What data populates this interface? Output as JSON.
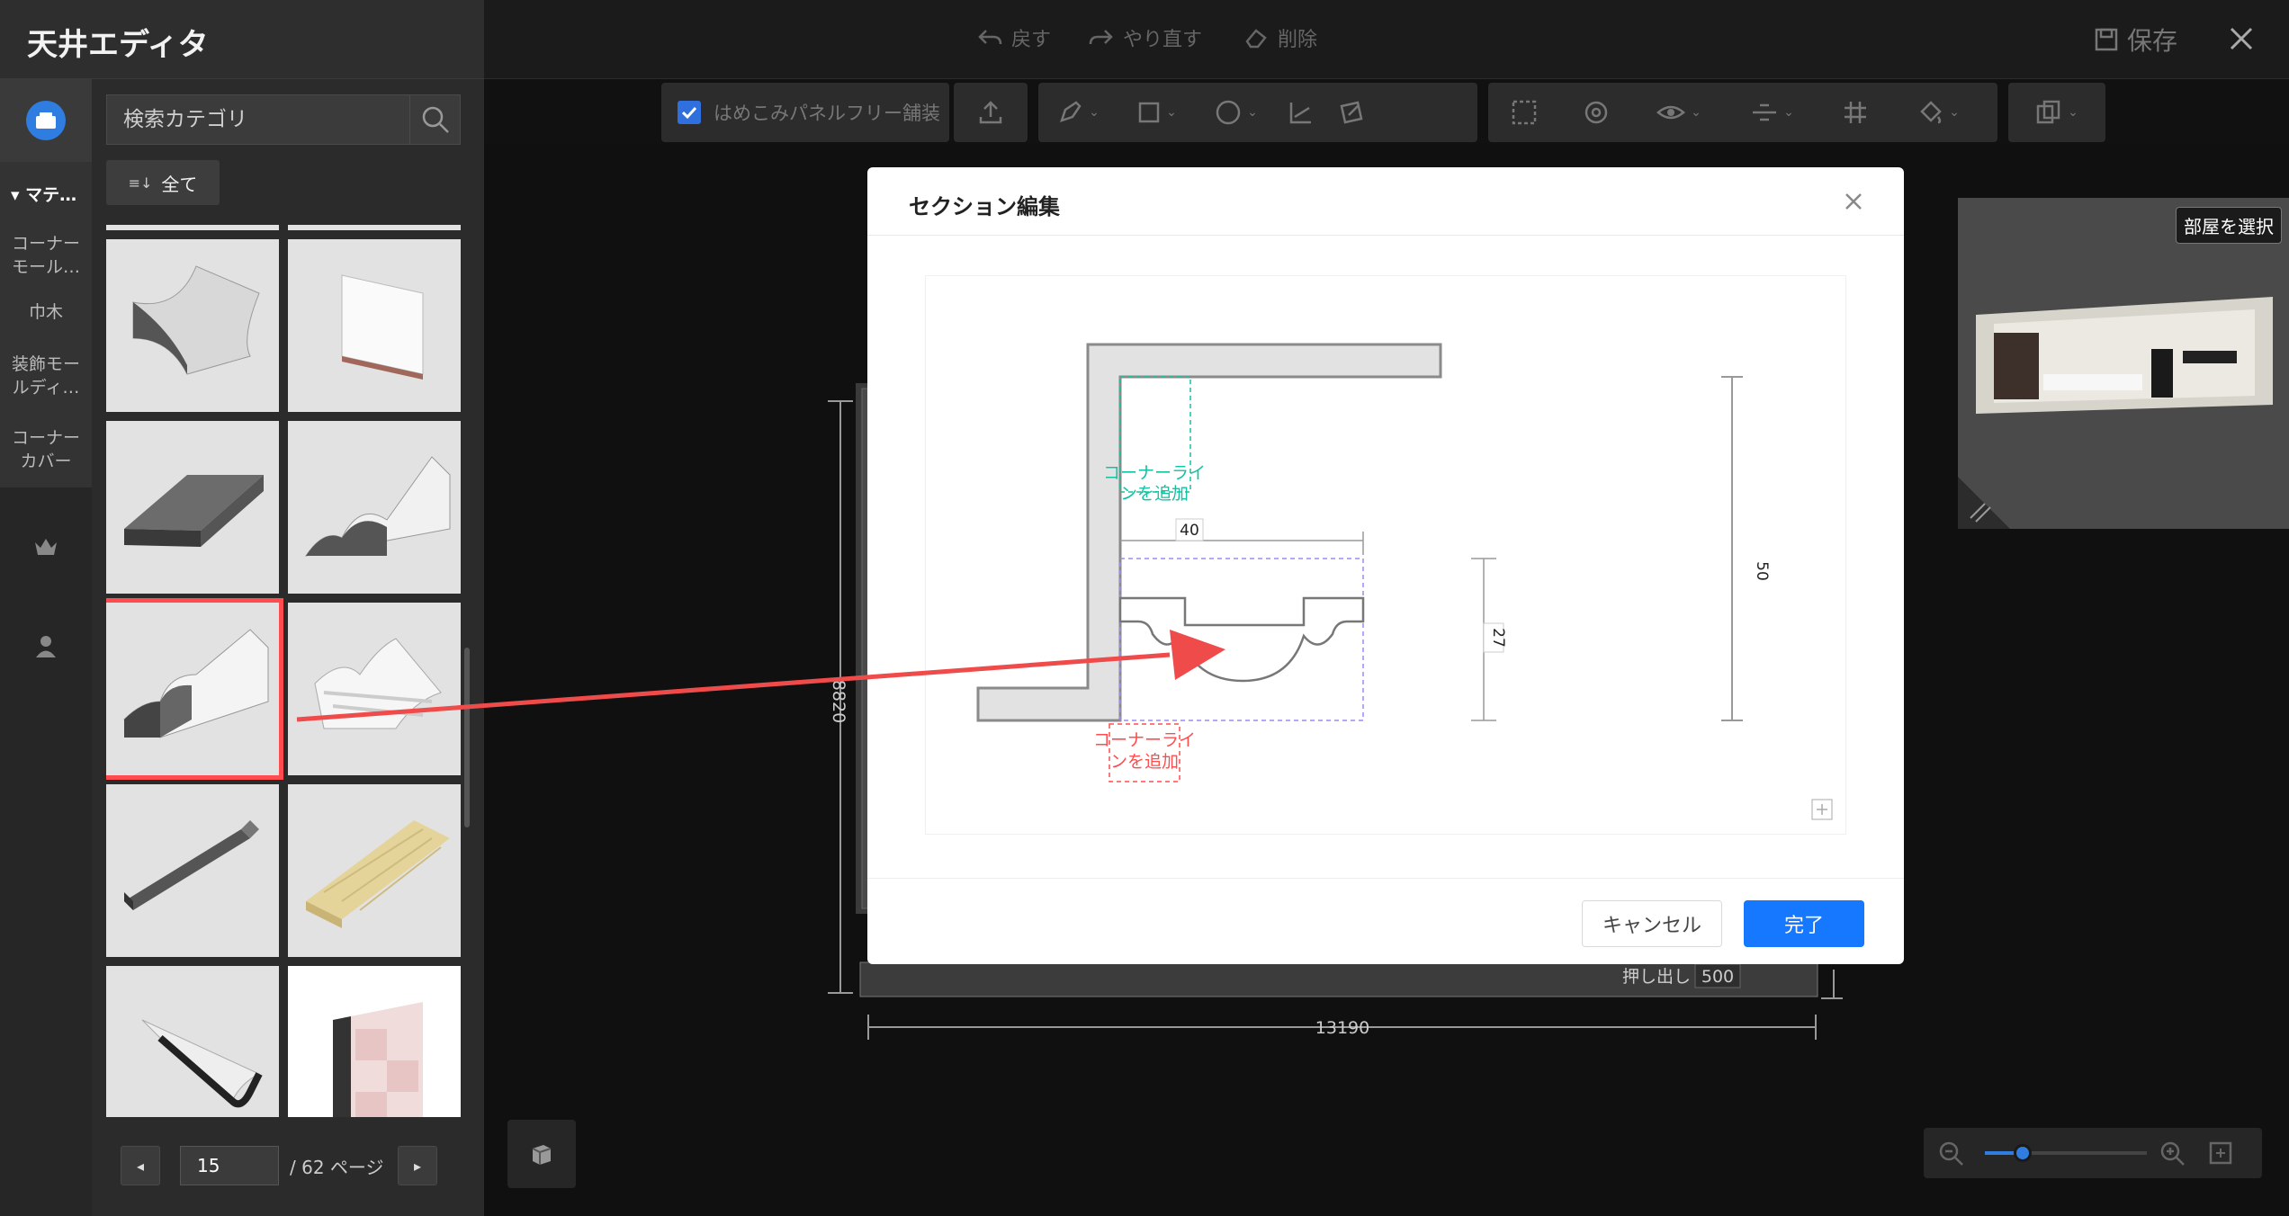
{
  "app": {
    "title": "天井エディタ"
  },
  "search": {
    "placeholder": "検索カテゴリ"
  },
  "filter": {
    "all_label": "全て"
  },
  "categories": {
    "heading": "マテ…",
    "items": [
      {
        "label": "コーナーモール…"
      },
      {
        "label": "巾木"
      },
      {
        "label": "装飾モールディ…"
      },
      {
        "label": "コーナーカバー"
      }
    ]
  },
  "rail_icons": [
    "material-icon",
    "crown-icon",
    "user-icon"
  ],
  "pager": {
    "current": "15",
    "total_label": "/ 62 ページ"
  },
  "topbar": {
    "undo": "戻す",
    "redo": "やり直す",
    "delete": "削除",
    "save": "保存"
  },
  "toolbar": {
    "fill_checkbox_label": "はめこみパネルフリー舗装"
  },
  "canvas": {
    "dim_width": "13190",
    "dim_height": "8820",
    "extrude_label": "押し出し",
    "extrude_value": "500"
  },
  "preview": {
    "select_room": "部屋を選択"
  },
  "modal": {
    "title": "セクション編集",
    "cancel": "キャンセル",
    "done": "完了",
    "add_corner_line_top": [
      "コーナーライ",
      "ンを追加"
    ],
    "add_corner_line_bottom": [
      "コーナーライ",
      "ンを追加"
    ],
    "dim_40": "40",
    "dim_27": "27",
    "dim_50": "50"
  },
  "colors": {
    "accent": "#1677ff",
    "highlight": "#ff4d4f",
    "corner_line_teal": "#13c2a2",
    "corner_line_red": "#ff4d4f",
    "profile_box": "#9b8cf2"
  }
}
